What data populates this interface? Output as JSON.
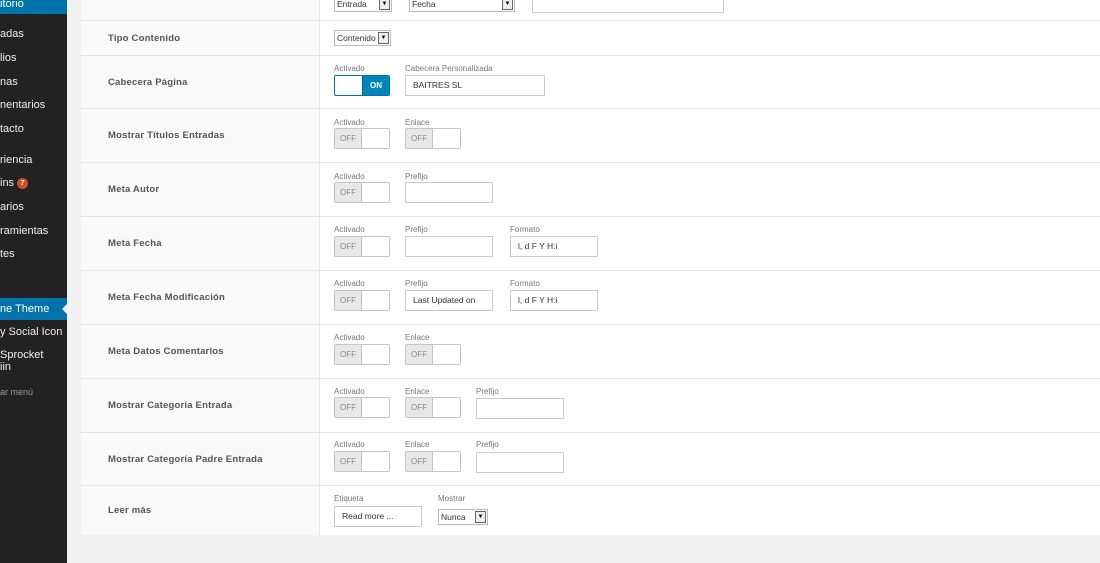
{
  "sidebar": {
    "items": [
      {
        "label": "itorio",
        "badge": ""
      },
      {
        "label": "adas",
        "badge": ""
      },
      {
        "label": "lios",
        "badge": ""
      },
      {
        "label": "nas",
        "badge": ""
      },
      {
        "label": "nentarios",
        "badge": ""
      },
      {
        "label": "tacto",
        "badge": ""
      },
      {
        "label": "riencia",
        "badge": ""
      },
      {
        "label": "ins",
        "badge": "7"
      },
      {
        "label": "arios",
        "badge": ""
      },
      {
        "label": "ramientas",
        "badge": ""
      },
      {
        "label": "tes",
        "badge": ""
      },
      {
        "label": "ne Theme",
        "badge": ""
      },
      {
        "label": "y Social Icon",
        "badge": ""
      },
      {
        "label": "Sprocket",
        "badge": ""
      },
      {
        "label": "iin",
        "badge": ""
      },
      {
        "label": "ar menú",
        "badge": ""
      }
    ]
  },
  "top": {
    "select1": "Entrada",
    "select2": "Fecha"
  },
  "rows": {
    "tipo": {
      "label": "Tipo Contenido",
      "select": "Contenido"
    },
    "cabecera": {
      "label": "Cabecera Página",
      "activado": "Activado",
      "toggle": "ON",
      "custom_label": "Cabecera Personalizada",
      "custom_value": "BAITRES SL"
    },
    "titulos": {
      "label": "Mostrar Títulos Entradas",
      "activado": "Activado",
      "toggle": "OFF",
      "enlace": "Enlace",
      "enlace_toggle": "OFF"
    },
    "autor": {
      "label": "Meta Autor",
      "activado": "Activado",
      "toggle": "OFF",
      "prefijo": "Prefijo",
      "prefijo_value": ""
    },
    "fecha": {
      "label": "Meta Fecha",
      "activado": "Activado",
      "toggle": "OFF",
      "prefijo": "Prefijo",
      "prefijo_value": "",
      "formato": "Formato",
      "formato_value": "l, d F Y H:i"
    },
    "fecha_mod": {
      "label": "Meta Fecha Modificación",
      "activado": "Activado",
      "toggle": "OFF",
      "prefijo": "Prefijo",
      "prefijo_value": "Last Updated on",
      "formato": "Formato",
      "formato_value": "l, d F Y H:i"
    },
    "comentarios": {
      "label": "Meta Datos Comentarios",
      "activado": "Activado",
      "toggle": "OFF",
      "enlace": "Enlace",
      "enlace_toggle": "OFF"
    },
    "categoria": {
      "label": "Mostrar Categoría Entrada",
      "activado": "Activado",
      "toggle": "OFF",
      "enlace": "Enlace",
      "enlace_toggle": "OFF",
      "prefijo": "Prefijo",
      "prefijo_value": ""
    },
    "categoria_padre": {
      "label": "Mostrar Categoría Padre Entrada",
      "activado": "Activado",
      "toggle": "OFF",
      "enlace": "Enlace",
      "enlace_toggle": "OFF",
      "prefijo": "Prefijo",
      "prefijo_value": ""
    },
    "leer_mas": {
      "label": "Leer más",
      "etiqueta": "Etiqueta",
      "etiqueta_value": "Read more ...",
      "mostrar": "Mostrar",
      "mostrar_value": "Nunca"
    }
  }
}
